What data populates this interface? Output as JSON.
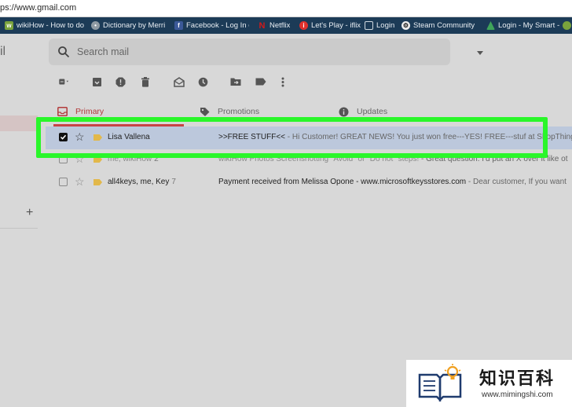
{
  "browser": {
    "url": "ps://www.gmail.com",
    "bookmarks": [
      {
        "label": "wikiHow - How to do",
        "icon": "wikihow-icon",
        "color": "#7aa33c"
      },
      {
        "label": "Dictionary by Merri",
        "icon": "dictionary-icon",
        "color": "#8f9aa3"
      },
      {
        "label": "Facebook - Log In or",
        "icon": "facebook-icon",
        "color": "#3b5998"
      },
      {
        "label": "Netflix",
        "icon": "netflix-icon",
        "color": "#d11a1a"
      },
      {
        "label": "Let's Play - iflix",
        "icon": "iflix-icon",
        "color": "#e0302c"
      },
      {
        "label": "Login",
        "icon": "document-icon",
        "color": "#cfd8df"
      },
      {
        "label": "Steam Community",
        "icon": "steam-icon",
        "color": "#222"
      },
      {
        "label": "Login - My Smart -",
        "icon": "smart-icon",
        "color": "#3fa45a"
      }
    ]
  },
  "gmail": {
    "logo_fragment": "il",
    "search": {
      "placeholder": "Search mail"
    },
    "tabs": [
      {
        "label": "Primary",
        "icon": "inbox-icon"
      },
      {
        "label": "Promotions",
        "icon": "tag-icon"
      },
      {
        "label": "Updates",
        "icon": "info-icon"
      }
    ],
    "emails": [
      {
        "sender": "Lisa Vallena",
        "count": "",
        "subject": ">>FREE STUFF<<",
        "snippet": " - Hi Customer! GREAT NEWS! You just won free---YES! FREE---stuf at ShopThings.co",
        "checked": true,
        "important": true
      },
      {
        "sender": "me, wikiHow",
        "count": "2",
        "subject": "wikiHow Photos  Screenshotting \"Avoid\" or \"Do not\" steps!",
        "snippet": " - Great question. I'd put an X over it like ot",
        "checked": false,
        "important": true
      },
      {
        "sender": "all4keys, me, Key",
        "count": "7",
        "subject": "Payment received from Melissa Opone - www.microsoftkeysstores.com",
        "snippet": " - Dear customer, If you want",
        "checked": false,
        "important": true
      }
    ]
  },
  "watermark": {
    "title": "知识百科",
    "url": "www.mimingshi.com"
  },
  "colors": {
    "highlight": "#2af62a",
    "primary_tab": "#c74343",
    "bookmark_bar": "#1c3b57"
  }
}
